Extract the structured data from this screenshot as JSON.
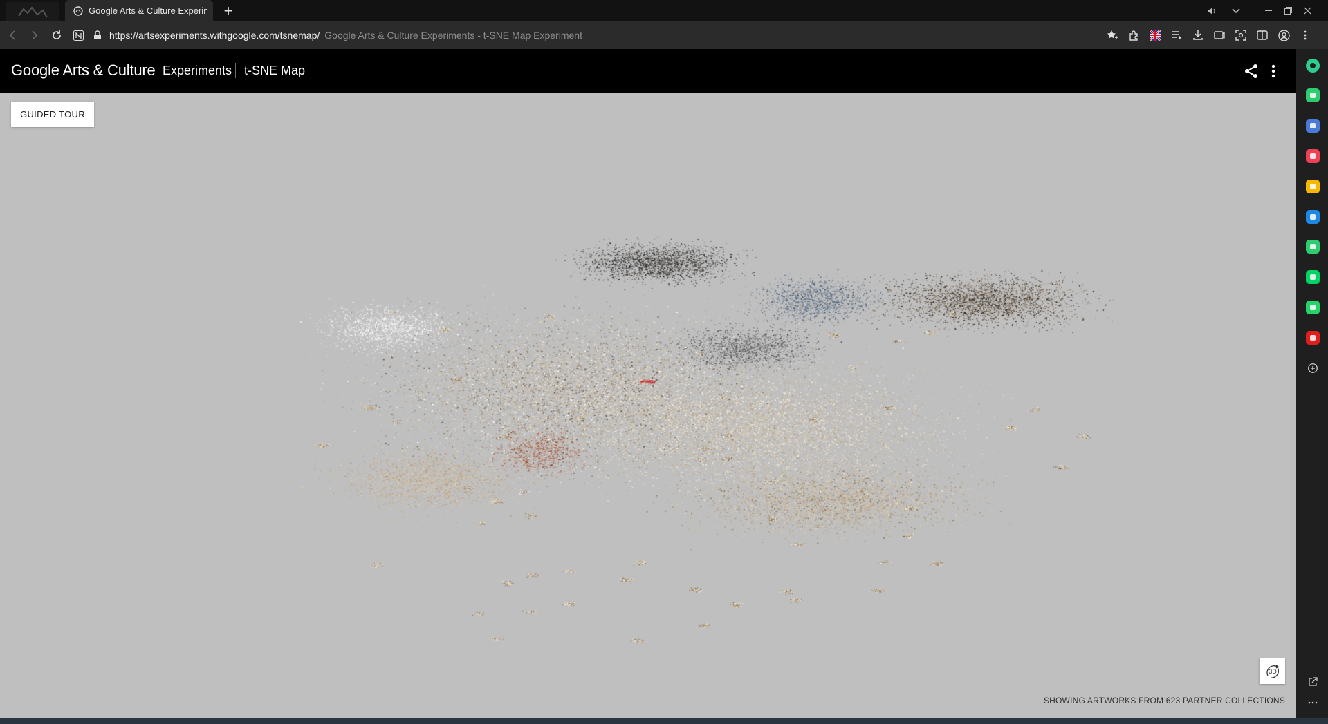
{
  "browser": {
    "tab_title": "Google Arts & Culture Experim",
    "url": "https://artsexperiments.withgoogle.com/tsnemap/",
    "page_title_hint": "Google Arts & Culture Experiments - t-SNE Map Experiment",
    "icons": {
      "tab_strip": [
        "tab-thumbnail-icon",
        "favicon-icon",
        "new-tab-icon",
        "volume-icon",
        "chevron-down-icon",
        "minimize-icon",
        "restore-icon",
        "close-icon"
      ],
      "nav": [
        "back-icon",
        "forward-icon",
        "reload-icon",
        "notion-icon",
        "lock-icon"
      ],
      "toolbar": [
        "star-add-icon",
        "extensions-icon",
        "flag-uk-icon",
        "playlist-icon",
        "download-icon",
        "tab-icon",
        "screenshot-icon",
        "split-view-icon",
        "profile-icon",
        "menu-dots-icon"
      ]
    }
  },
  "header": {
    "brand": "Google Arts & Culture",
    "link_experiments": "Experiments",
    "link_tsne": "t-SNE Map",
    "icons": [
      "share-icon",
      "more-vert-icon"
    ]
  },
  "map": {
    "guided_tour_label": "GUIDED TOUR",
    "toggle_3d_label": "3D",
    "partners_text": "SHOWING ARTWORKS FROM 623 PARTNER COLLECTIONS",
    "background_color": "#bfbfbf"
  },
  "sidebar": {
    "items": [
      {
        "name": "ai-assistant-icon",
        "color": "#2ecc8f"
      },
      {
        "name": "notification-icon",
        "color": "#2ecc71"
      },
      {
        "name": "wallet-icon",
        "color": "#4a7bd9"
      },
      {
        "name": "pocket-icon",
        "color": "#ef4056"
      },
      {
        "name": "favorites-icon",
        "color": "#f5b700"
      },
      {
        "name": "edge-icon",
        "color": "#1e88e5"
      },
      {
        "name": "player-icon",
        "color": "#2ecc71"
      },
      {
        "name": "webtoon-icon",
        "color": "#00d564"
      },
      {
        "name": "whatsapp-icon",
        "color": "#25d366"
      },
      {
        "name": "wow-icon",
        "color": "#e01e1e"
      },
      {
        "name": "add-icon",
        "color": "#dddddd"
      }
    ],
    "bottom_icons": [
      "external-link-icon",
      "more-horiz-icon"
    ]
  }
}
